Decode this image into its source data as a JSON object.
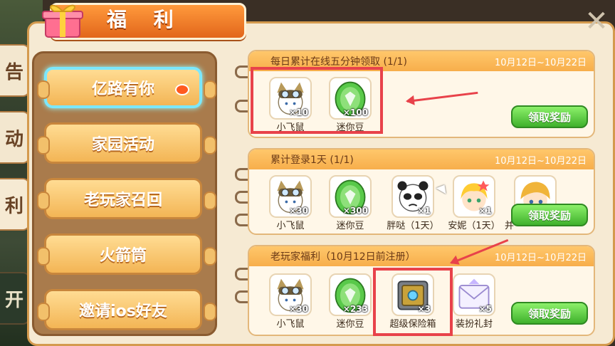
{
  "window": {
    "title": "福 利",
    "close_icon": "close-icon"
  },
  "side_tabs": [
    {
      "label": "告"
    },
    {
      "label": "动"
    },
    {
      "label": "利"
    },
    {
      "label": "开"
    }
  ],
  "nav": [
    {
      "label": "亿路有你",
      "active": true
    },
    {
      "label": "家园活动"
    },
    {
      "label": "老玩家召回"
    },
    {
      "label": "火箭筒"
    },
    {
      "label": "邀请ios好友"
    }
  ],
  "cards": [
    {
      "title": "每日累计在线五分钟领取 (1/1)",
      "date": "10月12日~10月22日",
      "claim_label": "领取奖励",
      "items": [
        {
          "name": "小飞鼠",
          "qty": "×10",
          "icon": "goggle-cat-icon"
        },
        {
          "name": "迷你豆",
          "qty": "×100",
          "icon": "green-bean-icon"
        }
      ]
    },
    {
      "title": "累计登录1天 (1/1)",
      "date": "10月12日~10月22日",
      "claim_label": "领取奖励",
      "items": [
        {
          "name": "小飞鼠",
          "qty": "×30",
          "icon": "goggle-cat-icon"
        },
        {
          "name": "迷你豆",
          "qty": "×300",
          "icon": "green-bean-icon"
        },
        {
          "name": "胖哒（1天）",
          "qty": "×1",
          "icon": "panda-avatar-icon"
        },
        {
          "name": "安妮（1天）",
          "qty": "×1",
          "icon": "blonde-girl-avatar-icon"
        },
        {
          "name": "并",
          "qty": "",
          "icon": "blonde-boy-avatar-icon"
        }
      ]
    },
    {
      "title": "老玩家福利（10月12日前注册）",
      "date": "10月12日~10月22日",
      "claim_label": "领取奖励",
      "items": [
        {
          "name": "小飞鼠",
          "qty": "×30",
          "icon": "goggle-cat-icon"
        },
        {
          "name": "迷你豆",
          "qty": "×233",
          "icon": "green-bean-icon"
        },
        {
          "name": "超级保险箱",
          "qty": "×3",
          "icon": "safe-box-icon"
        },
        {
          "name": "装扮礼封",
          "qty": "×5",
          "icon": "gift-envelope-icon"
        }
      ]
    }
  ],
  "colors": {
    "accent": "#f7ae4b",
    "claim": "#3fb12c",
    "highlight": "#e8424a",
    "active_border": "#7be8ff"
  }
}
